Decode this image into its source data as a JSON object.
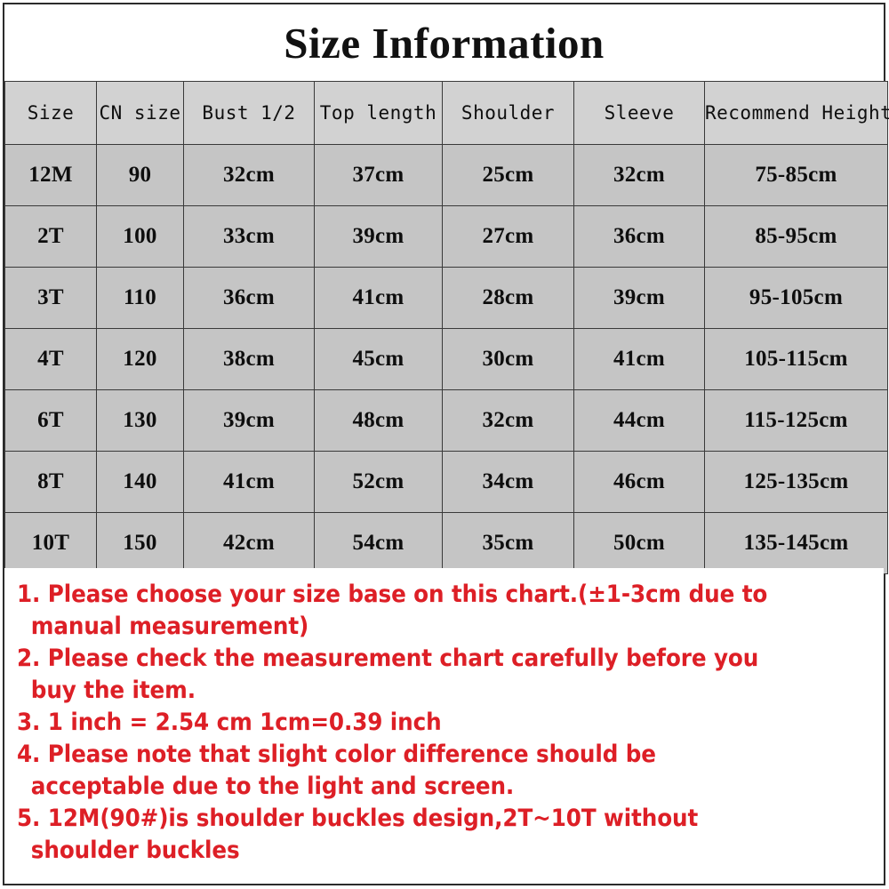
{
  "title": "Size Information",
  "table": {
    "headers": [
      "Size",
      "CN size",
      "Bust 1/2",
      "Top length",
      "Shoulder",
      "Sleeve",
      "Recommend Height"
    ],
    "rows": [
      {
        "size": "12M",
        "cn_size": "90",
        "bust_half": "32cm",
        "top_length": "37cm",
        "shoulder": "25cm",
        "sleeve": "32cm",
        "recommend_height": "75-85cm"
      },
      {
        "size": "2T",
        "cn_size": "100",
        "bust_half": "33cm",
        "top_length": "39cm",
        "shoulder": "27cm",
        "sleeve": "36cm",
        "recommend_height": "85-95cm"
      },
      {
        "size": "3T",
        "cn_size": "110",
        "bust_half": "36cm",
        "top_length": "41cm",
        "shoulder": "28cm",
        "sleeve": "39cm",
        "recommend_height": "95-105cm"
      },
      {
        "size": "4T",
        "cn_size": "120",
        "bust_half": "38cm",
        "top_length": "45cm",
        "shoulder": "30cm",
        "sleeve": "41cm",
        "recommend_height": "105-115cm"
      },
      {
        "size": "6T",
        "cn_size": "130",
        "bust_half": "39cm",
        "top_length": "48cm",
        "shoulder": "32cm",
        "sleeve": "44cm",
        "recommend_height": "115-125cm"
      },
      {
        "size": "8T",
        "cn_size": "140",
        "bust_half": "41cm",
        "top_length": "52cm",
        "shoulder": "34cm",
        "sleeve": "46cm",
        "recommend_height": "125-135cm"
      },
      {
        "size": "10T",
        "cn_size": "150",
        "bust_half": "42cm",
        "top_length": "54cm",
        "shoulder": "35cm",
        "sleeve": "50cm",
        "recommend_height": "135-145cm"
      }
    ]
  },
  "notes": {
    "lines": [
      "1. Please choose your size base on this chart.(±1-3cm due to",
      "manual measurement)",
      "2. Please check the measurement chart carefully before you",
      "buy the item.",
      "3. 1 inch = 2.54 cm  1cm=0.39 inch",
      "4. Please note that slight color difference should be",
      "acceptable due to the light and screen.",
      "5. 12M(90#)is shoulder buckles design,2T~10T without",
      "shoulder buckles"
    ]
  },
  "colors": {
    "note_red": "#dd1f26",
    "header_bg": "#d2d2d2",
    "cell_bg": "#c5c5c5",
    "border": "#3a3a3a",
    "text": "#0e0e0e"
  }
}
